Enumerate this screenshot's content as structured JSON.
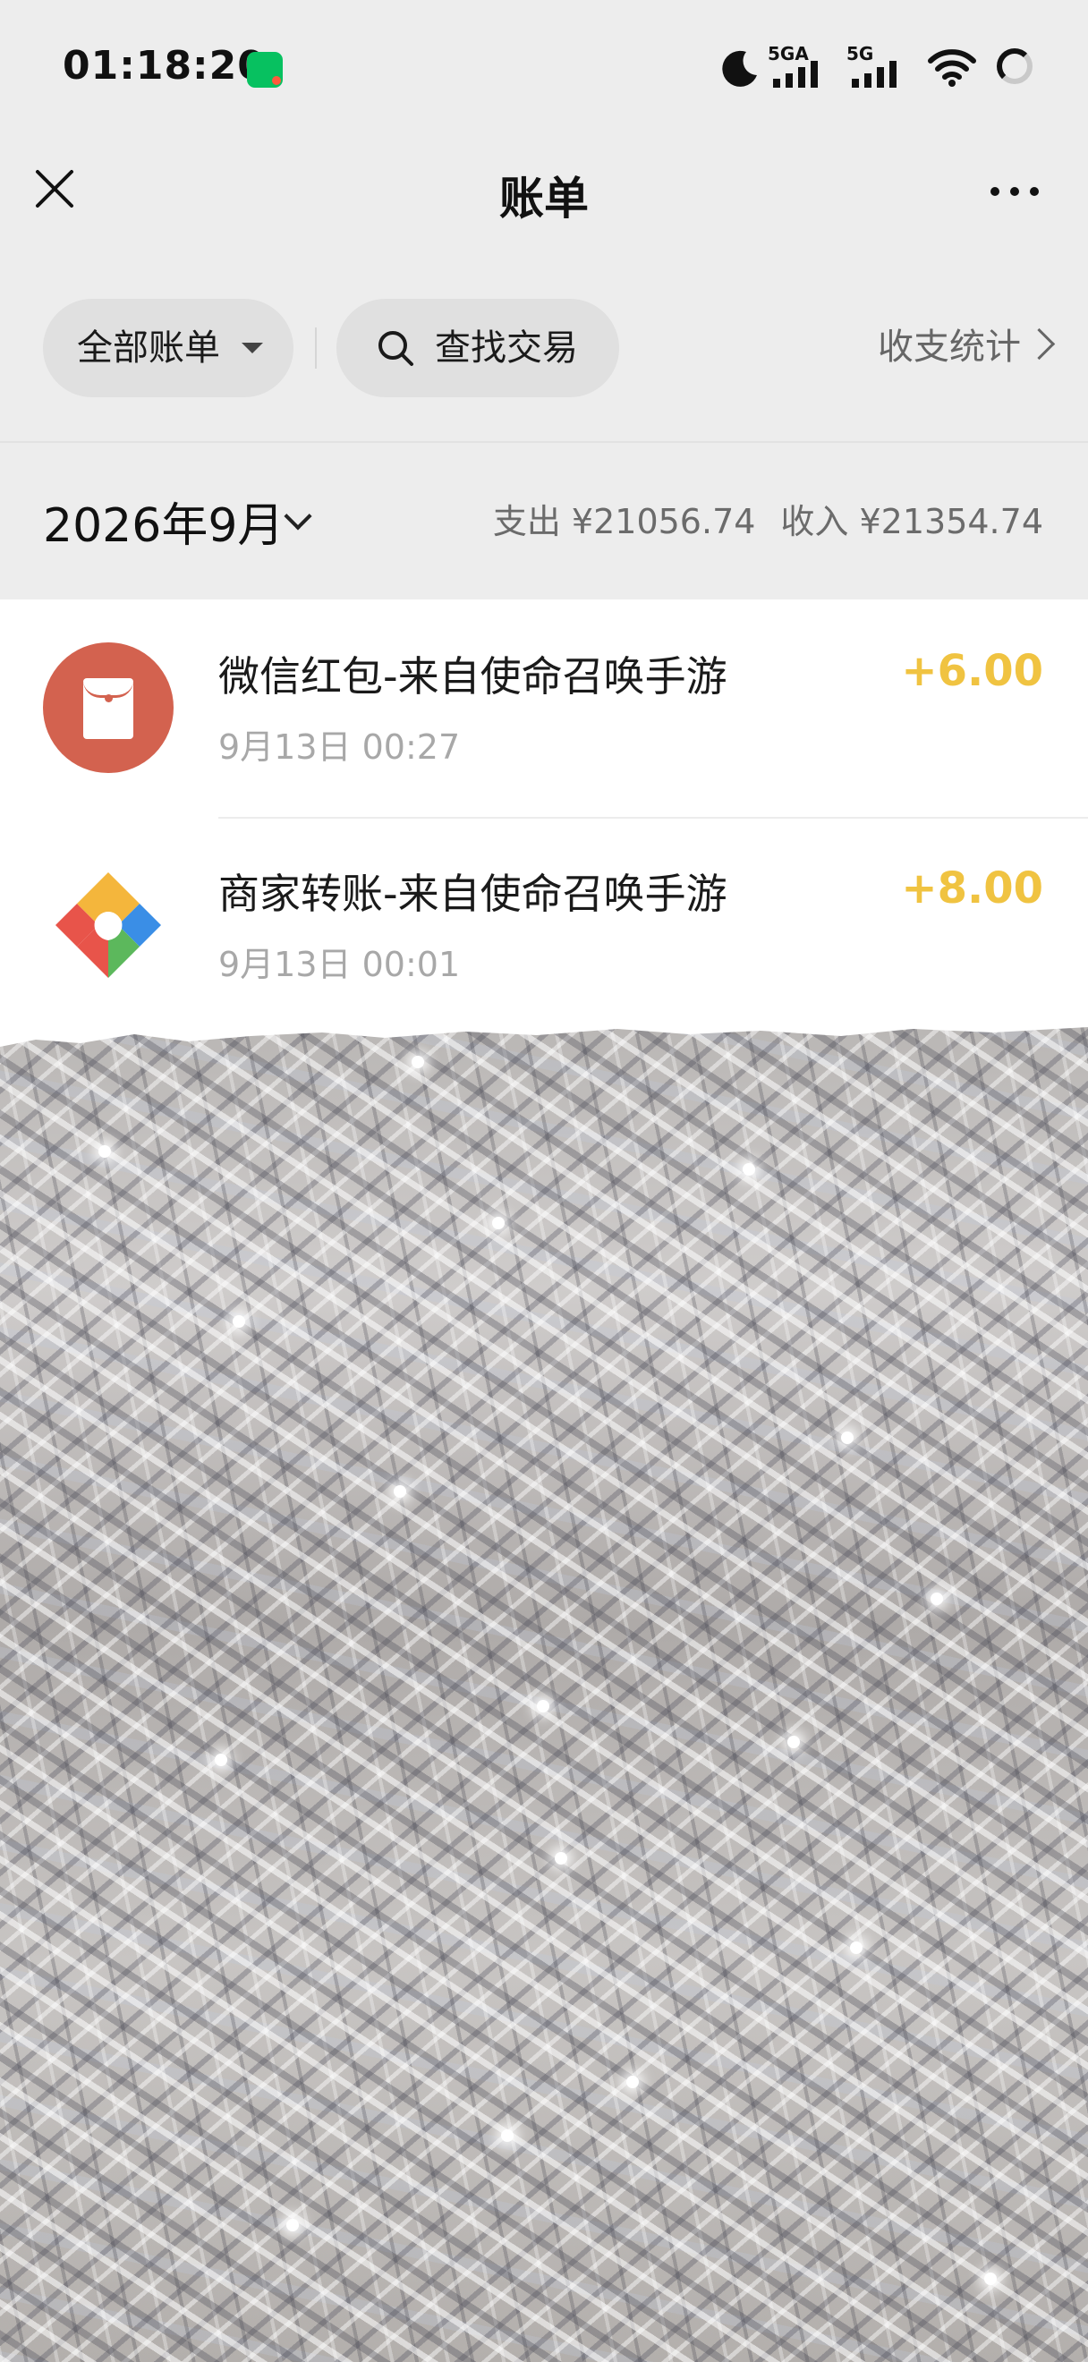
{
  "status_bar": {
    "time": "01:18:20",
    "network_1": "5GA",
    "network_2": "5G"
  },
  "title_bar": {
    "title": "账单"
  },
  "filters": {
    "all_bills": "全部账单",
    "search": "查找交易",
    "stats": "收支统计"
  },
  "summary": {
    "month": "2026年9月",
    "expense": "支出 ¥21056.74",
    "income": "收入 ¥21354.74"
  },
  "transactions": [
    {
      "name": "微信红包-来自使命召唤手游",
      "date": "9月13日 00:27",
      "amount": "+6.00",
      "icon": "red-packet-icon"
    },
    {
      "name": "商家转账-来自使命召唤手游",
      "date": "9月13日 00:01",
      "amount": "+8.00",
      "icon": "merchant-transfer-icon"
    }
  ],
  "colors": {
    "amount_positive": "#f0c341",
    "red_packet": "#d3624f",
    "background": "#ededed"
  }
}
